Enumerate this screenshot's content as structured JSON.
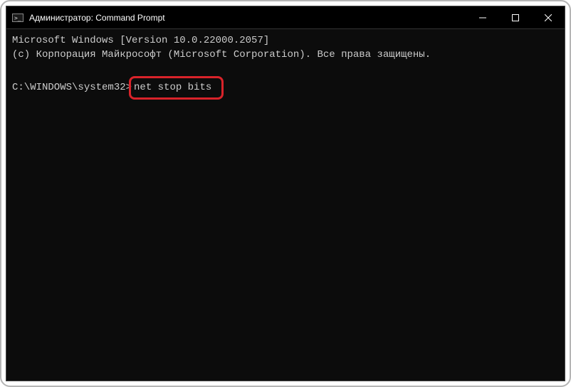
{
  "titlebar": {
    "title": "Администратор: Command Prompt"
  },
  "terminal": {
    "line1": "Microsoft Windows [Version 10.0.22000.2057]",
    "line2": "(c) Корпорация Майкрософт (Microsoft Corporation). Все права защищены.",
    "prompt_path": "C:\\WINDOWS\\system32>",
    "command": "net stop bits"
  }
}
